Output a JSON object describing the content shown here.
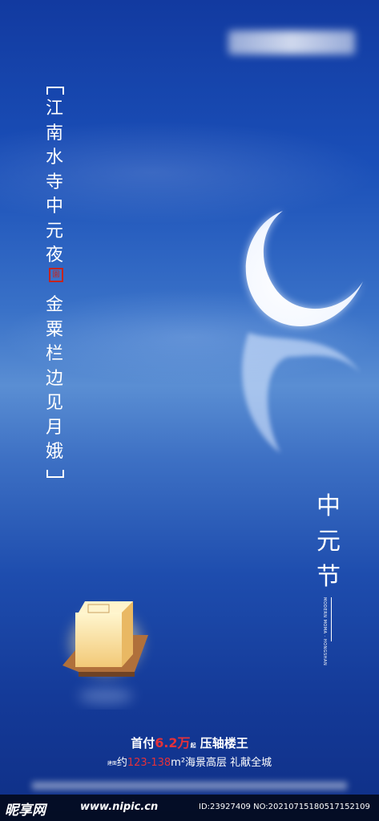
{
  "poem_line_1": [
    "江",
    "南",
    "水",
    "寺",
    "中",
    "元",
    "夜"
  ],
  "seal_text": "園",
  "poem_line_2": [
    "金",
    "粟",
    "栏",
    "边",
    "见",
    "月",
    "娥"
  ],
  "festival_title": [
    "中",
    "元",
    "节"
  ],
  "side_text_en": "MODERN MOMA · HONGSHAN",
  "offer": {
    "prefix": "首付",
    "amount": "6.2万",
    "tag": "起",
    "suffix": "压轴楼王"
  },
  "detail": {
    "tag": "建面",
    "prefix": "约",
    "range": "123-138",
    "unit": "m²",
    "suffix": "海景高层  礼献全城"
  },
  "watermark": {
    "brand": "昵享网",
    "url": "www.nipic.cn",
    "id": "ID:23927409 NO:20210715180517152109"
  },
  "colors": {
    "sky_top": "#123aa0",
    "horizon": "#5a8ed3",
    "accent_red": "#e4313a"
  }
}
